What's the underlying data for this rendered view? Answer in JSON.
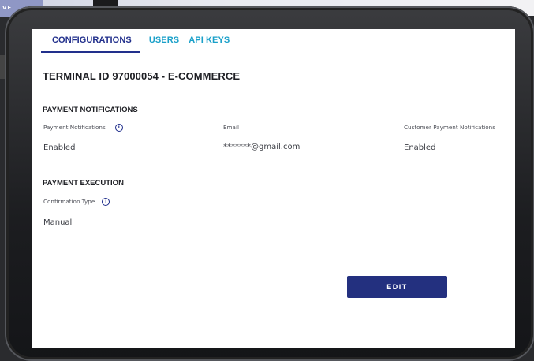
{
  "background": {
    "chip_label": "VE"
  },
  "tabs": [
    {
      "label": "CONFIGURATIONS",
      "active": true
    },
    {
      "label": "USERS",
      "active": false
    },
    {
      "label": "API KEYS",
      "active": false
    }
  ],
  "terminal": {
    "title": "TERMINAL ID 97000054 - E-COMMERCE"
  },
  "payment_notifications": {
    "heading": "PAYMENT NOTIFICATIONS",
    "fields": [
      {
        "label": "Payment Notifications",
        "value": "Enabled",
        "info_icon": true
      },
      {
        "label": "Email",
        "value": "*******@gmail.com",
        "info_icon": false
      },
      {
        "label": "Customer Payment Notifications",
        "value": "Enabled",
        "info_icon": false
      }
    ]
  },
  "payment_execution": {
    "heading": "PAYMENT EXECUTION",
    "fields": [
      {
        "label": "Confirmation Type",
        "value": "Manual",
        "info_icon": true
      }
    ]
  },
  "actions": {
    "edit_label": "EDIT"
  },
  "colors": {
    "primary": "#23307f",
    "tab_link": "#1aa0c9",
    "heading": "#1e1f24"
  },
  "icons": {
    "info": "info-icon"
  }
}
